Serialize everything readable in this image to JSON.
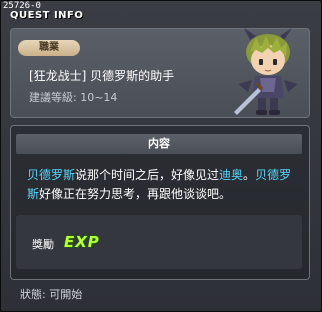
{
  "quest_code": "25726-0",
  "title": "QUEST INFO",
  "job_label": "職業",
  "quest_name": "[狂龙战士] 贝德罗斯的助手",
  "required_level": "建議等級: 10~14",
  "content_header": "内容",
  "content": {
    "part1": "贝德罗斯",
    "part2": "说那个时间之后，好像见过",
    "part3": "迪奥",
    "part4": "。",
    "part5": "贝德罗斯",
    "part6": "好像正在努力思考，再跟他谈谈吧。"
  },
  "reward_label": "獎勵",
  "reward_exp": "EXP",
  "status": "狀態:  可開始",
  "colors": {
    "highlight": "#58d8ff",
    "exp": "#b8ff3c",
    "job_badge": "#d9c3a0"
  },
  "icons": {
    "npc": "npc-portrait-horned-swordsman"
  }
}
